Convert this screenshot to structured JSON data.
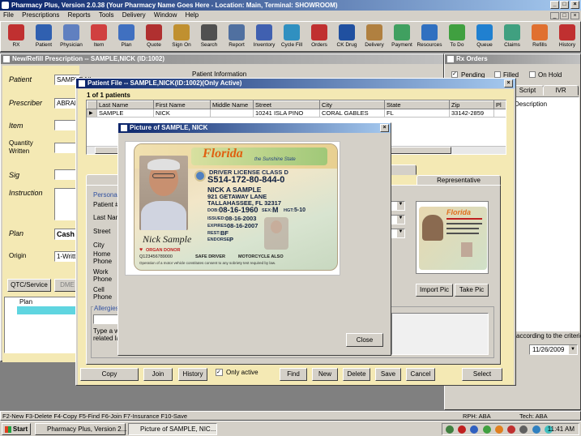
{
  "app": {
    "title": "Pharmacy Plus, Version 2.0.38 (Your Pharmacy Name Goes Here - Location: Main, Terminal: SHOWROOM)",
    "menu": [
      "File",
      "Prescriptions",
      "Reports",
      "Tools",
      "Delivery",
      "Window",
      "Help"
    ]
  },
  "toolbar": [
    {
      "label": "RX",
      "icon": "rx-icon",
      "color": "#c03030"
    },
    {
      "label": "Patient",
      "icon": "patient-icon",
      "color": "#3060b0"
    },
    {
      "label": "Physician",
      "icon": "physician-icon",
      "color": "#6080c0"
    },
    {
      "label": "Item",
      "icon": "pill-icon",
      "color": "#d04040"
    },
    {
      "label": "Plan",
      "icon": "plan-icon",
      "color": "#4070c0"
    },
    {
      "label": "Quote",
      "icon": "quote-icon",
      "color": "#b03030"
    },
    {
      "label": "Sign On",
      "icon": "lock-icon",
      "color": "#c09030"
    },
    {
      "label": "Search",
      "icon": "magnifier-icon",
      "color": "#505050"
    },
    {
      "label": "Report",
      "icon": "report-icon",
      "color": "#5070a0"
    },
    {
      "label": "Inventory",
      "icon": "inventory-icon",
      "color": "#4060b0"
    },
    {
      "label": "Cycle Fill",
      "icon": "funnel-icon",
      "color": "#3090c0"
    },
    {
      "label": "Orders",
      "icon": "orders-icon",
      "color": "#c03030"
    },
    {
      "label": "CK Drug",
      "icon": "checkmark-icon",
      "color": "#2050a0"
    },
    {
      "label": "Delivery",
      "icon": "box-icon",
      "color": "#b08040"
    },
    {
      "label": "Payment",
      "icon": "money-icon",
      "color": "#40a060"
    },
    {
      "label": "Resources",
      "icon": "globe-icon",
      "color": "#3070c0"
    },
    {
      "label": "To Do",
      "icon": "todo-icon",
      "color": "#40a040"
    },
    {
      "label": "Queue",
      "icon": "queue-icon",
      "color": "#2080d0"
    },
    {
      "label": "Claims",
      "icon": "claims-icon",
      "color": "#40a080"
    },
    {
      "label": "Refills",
      "icon": "refills-icon",
      "color": "#e07030"
    },
    {
      "label": "History",
      "icon": "history-icon",
      "color": "#c03030"
    }
  ],
  "rx_window": {
    "title": "New/Refill Prescription -- SAMPLE,NICK (ID:1002)",
    "labels": {
      "patient": "Patient",
      "prescriber": "Prescriber",
      "item": "Item",
      "quantity": "Quantity",
      "written": "Written",
      "sig": "Sig",
      "instruction": "Instruction",
      "plan": "Plan",
      "origin": "Origin"
    },
    "patient_value": "SAMPLE,NI",
    "prescriber_value": "ABRAN",
    "plan_value": "Cash",
    "origin_value": "1-Writte",
    "patient_info_label": "Patient Information",
    "otc_button": "QTC/Service",
    "dme_button": "DME",
    "plan_header": "Plan"
  },
  "rx_orders": {
    "title": "Rx Orders",
    "pending": "Pending",
    "filled": "Filled",
    "on_hold": "On Hold",
    "tabs": [
      "Script",
      "IVR"
    ],
    "col_description": "Description",
    "criteria_text": "according to the criterion",
    "date_value": "11/26/2009"
  },
  "patient_file": {
    "title": "Patient File -- SAMPLE,NICK(ID:1002)(Only Active)",
    "count": "1 of 1 patients",
    "columns": [
      "Last Name",
      "First Name",
      "Middle Name",
      "Street",
      "City",
      "State",
      "Zip",
      "Pl"
    ],
    "rows": [
      [
        "SAMPLE",
        "NICK",
        "",
        "10241 ISLA PINO",
        "CORAL GABLES",
        "FL",
        "33142-2859",
        ""
      ]
    ],
    "tabs": [
      "Ge",
      "ts",
      "Representative"
    ],
    "personal_label": "Personal",
    "fields": [
      "Patient #",
      "Last Name",
      "Street",
      "City",
      "Home Phone",
      "Work Phone",
      "Cell Phone"
    ],
    "allergies_label": "Allergies",
    "allergy_note": "Type a w related la",
    "import_pic": "Import Pic",
    "take_pic": "Take Pic",
    "buttons": {
      "copy": "Copy",
      "join": "Join",
      "history": "History",
      "only_active": "Only active",
      "find": "Find",
      "new": "New",
      "delete": "Delete",
      "save": "Save",
      "cancel": "Cancel",
      "select": "Select"
    }
  },
  "picture_dialog": {
    "title": "Picture of SAMPLE, NICK",
    "close": "Close",
    "license": {
      "state": "Florida",
      "tagline": "the Sunshine State",
      "license_class": "DRIVER LICENSE CLASS D",
      "number": "S514-172-80-844-0",
      "name": "NICK A SAMPLE",
      "address1": "921 GETAWAY LANE",
      "address2": "TALLAHASSEE, FL 32317",
      "dob_label": "DOB:",
      "dob": "08-16-1960",
      "sex_label": "SEX:",
      "sex": "M",
      "hgt_label": "HGT:",
      "hgt": "5-10",
      "issued_label": "ISSUED:",
      "issued": "08-16-2003",
      "expires_label": "EXPIRES:",
      "expires": "08-16-2007",
      "rest_label": "REST:",
      "rest": "BF",
      "endorse_label": "ENDORSE:",
      "endorse": "P",
      "signature": "Nick Sample",
      "organ_donor": "ORGAN DONOR",
      "safe_driver": "SAFE DRIVER",
      "motorcycle": "MOTORCYCLE ALSO",
      "barcode_number": "Q123456789000",
      "footer": "Operation of a motor vehicle constitutes consent to any sobriety test required by law."
    }
  },
  "statusbar": {
    "shortcuts": "F2-New  F3-Delete  F4-Copy  F5-Find  F6-Join  F7-Insurance  F10-Save",
    "rph": "RPH: ABA",
    "tech": "Tech: ABA"
  },
  "taskbar": {
    "start": "Start",
    "items": [
      "Pharmacy Plus, Version 2...",
      "Picture of SAMPLE, NIC..."
    ],
    "time": "11:41 AM"
  }
}
